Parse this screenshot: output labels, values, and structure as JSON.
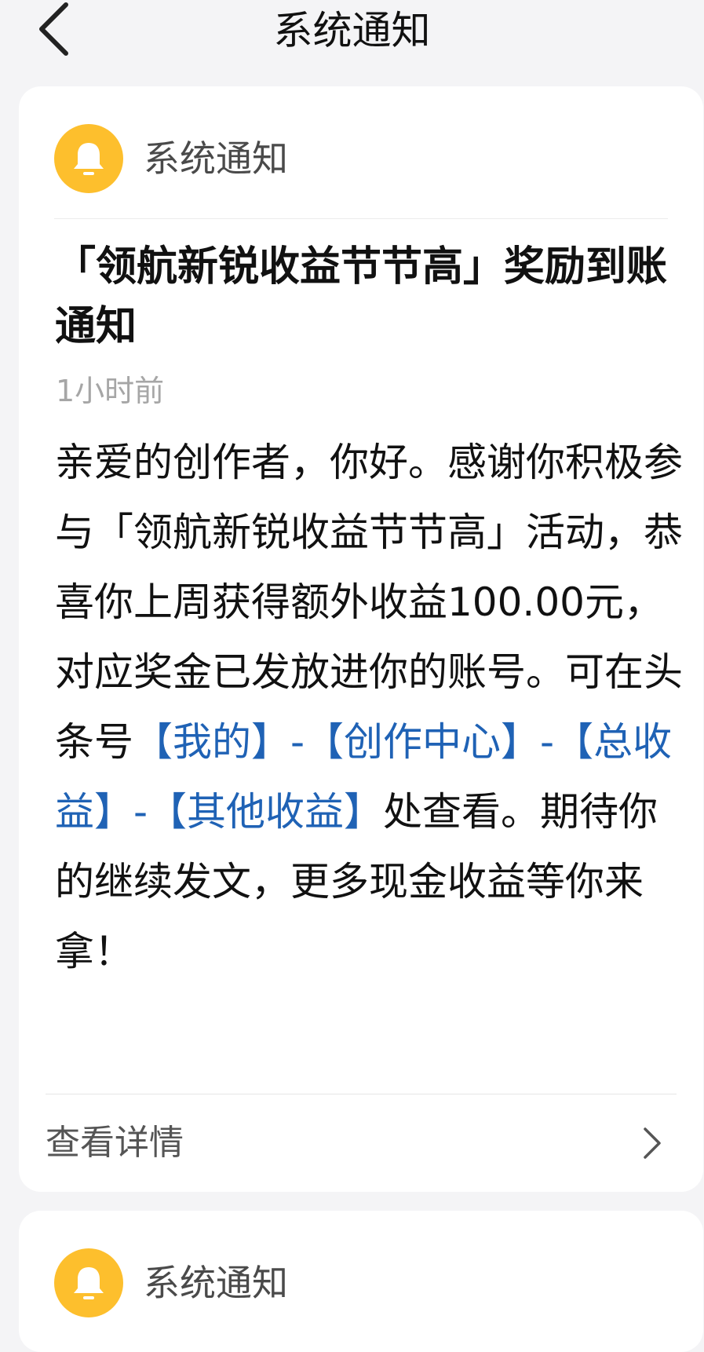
{
  "header": {
    "title": "系统通知",
    "back_icon": "back-arrow-icon"
  },
  "notifications": [
    {
      "sender": "系统通知",
      "icon": "bell-icon",
      "title": "「领航新锐收益节节高」奖励到账通知",
      "time": "1小时前",
      "body": {
        "part1": "亲爱的创作者，你好。感谢你积极参与「领航新锐收益节节高」活动，恭喜你上周获得额外收益100.00元，对应奖金已发放进你的账号。可在头条号",
        "link1": "【我的】",
        "sep1": "-",
        "link2": "【创作中心】",
        "sep2": "-",
        "link3": "【总收益】",
        "sep3": "-",
        "link4": "【其他收益】",
        "part2": "处查看。期待你的继续发文，更多现金收益等你来拿！"
      },
      "detail_label": "查看详情"
    },
    {
      "sender": "系统通知",
      "icon": "bell-icon"
    }
  ],
  "colors": {
    "background": "#f4f4f6",
    "card": "#ffffff",
    "bell": "#fdbf2d",
    "link": "#1f62b5",
    "muted": "#a6a6a6"
  }
}
